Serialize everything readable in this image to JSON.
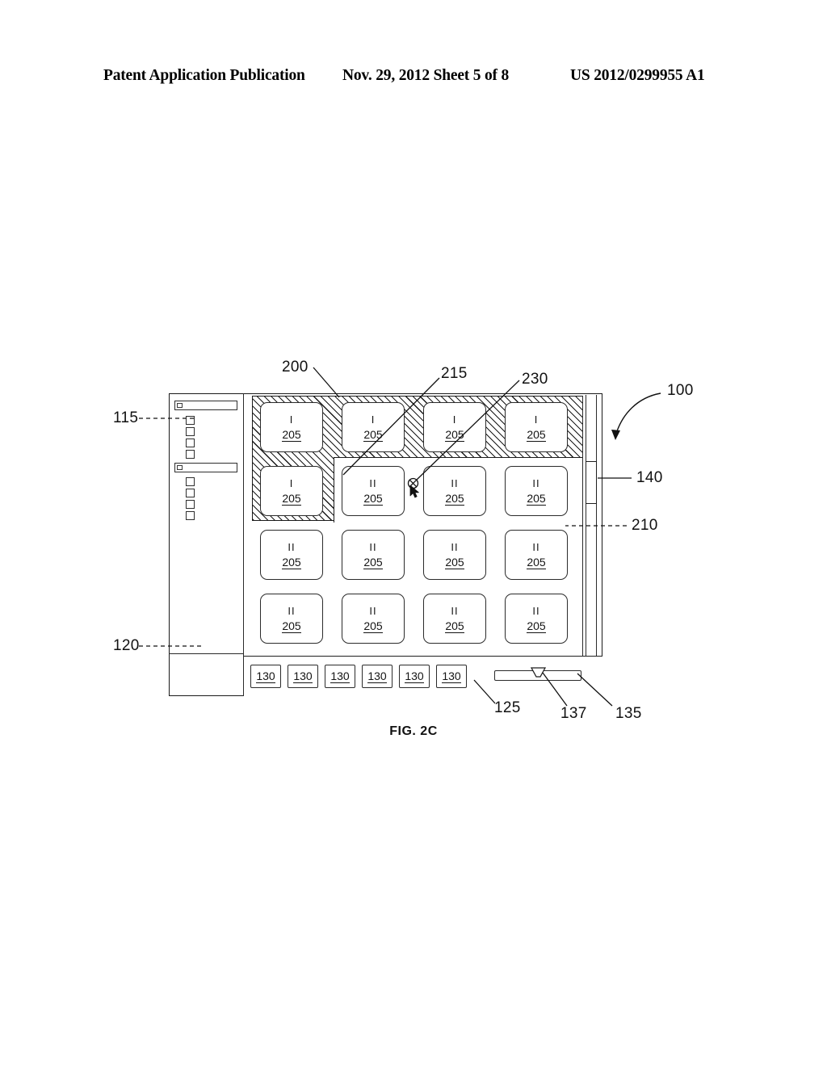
{
  "header": {
    "left": "Patent Application Publication",
    "date_sheet": "Nov. 29, 2012  Sheet 5 of 8",
    "publication_number": "US 2012/0299955 A1"
  },
  "figure": {
    "caption": "FIG. 2C",
    "device_ref": "100"
  },
  "sidebar": {
    "ref_upper": "115",
    "ref_lower": "120",
    "bars": [
      {
        "name": "sidebar-bar-1"
      },
      {
        "name": "sidebar-bar-2"
      }
    ],
    "squares_group_1": 4,
    "squares_group_2": 4
  },
  "content": {
    "pane_ref": "125",
    "selection_ref": "200",
    "selection_edge_ref": "215",
    "cursor_ref": "230",
    "scroll_track_ref": "210",
    "scroll_thumb_ref": "140"
  },
  "grid": {
    "cell_ref": "205",
    "columns": 4,
    "rows": [
      {
        "cells": [
          {
            "roman": "I"
          },
          {
            "roman": "I"
          },
          {
            "roman": "I"
          },
          {
            "roman": "I"
          }
        ]
      },
      {
        "cells": [
          {
            "roman": "I"
          },
          {
            "roman": "II"
          },
          {
            "roman": "II"
          },
          {
            "roman": "II"
          }
        ]
      },
      {
        "cells": [
          {
            "roman": "II"
          },
          {
            "roman": "II"
          },
          {
            "roman": "II"
          },
          {
            "roman": "II"
          }
        ]
      },
      {
        "cells": [
          {
            "roman": "II"
          },
          {
            "roman": "II"
          },
          {
            "roman": "II"
          },
          {
            "roman": "II"
          }
        ]
      }
    ],
    "selected_cell_count": 5
  },
  "toolbar": {
    "pane_ref": "125",
    "buttons": [
      {
        "label": "130"
      },
      {
        "label": "130"
      },
      {
        "label": "130"
      },
      {
        "label": "130"
      },
      {
        "label": "130"
      },
      {
        "label": "130"
      }
    ],
    "slider_ref": "135",
    "slider_marker_ref": "137"
  }
}
